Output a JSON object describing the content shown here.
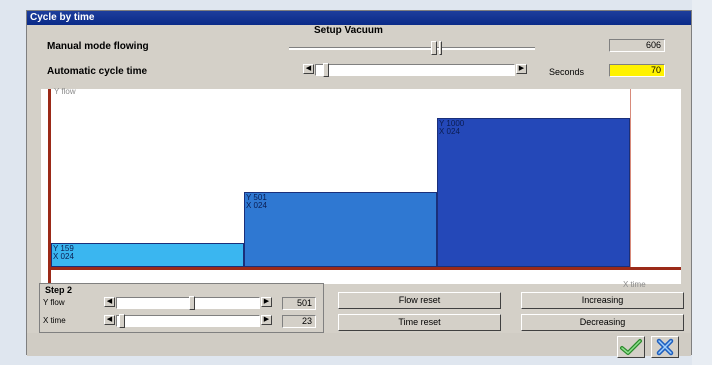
{
  "window": {
    "title": "Cycle by time"
  },
  "setup": {
    "section_title": "Setup Vacuum",
    "manual_label": "Manual mode flowing",
    "manual_value": "606",
    "auto_label": "Automatic cycle time",
    "seconds_label": "Seconds",
    "seconds_value": "70"
  },
  "chart_data": {
    "type": "bar",
    "ylabel": "Y flow",
    "xlabel": "X time",
    "ylim": [
      0,
      1000
    ],
    "bars": [
      {
        "label": "Y 159",
        "sub": "X 024",
        "x_start": 0,
        "x_end": 24,
        "y": 159
      },
      {
        "label": "Y 501",
        "sub": "X 024",
        "x_start": 24,
        "x_end": 48,
        "y": 501
      },
      {
        "label": "Y 1000",
        "sub": "X 024",
        "x_start": 48,
        "x_end": 72,
        "y": 1000
      }
    ],
    "colors": [
      "#3ab6f0",
      "#2f78d2",
      "#2448b8"
    ]
  },
  "step": {
    "title": "Step 2",
    "y_label": "Y flow",
    "y_value": "501",
    "x_label": "X time",
    "x_value": "23"
  },
  "buttons": {
    "flow_reset": "Flow reset",
    "time_reset": "Time reset",
    "increasing": "Increasing",
    "decreasing": "Decreasing"
  },
  "icons": {
    "ok": "checkmark-icon",
    "cancel": "close-icon"
  }
}
